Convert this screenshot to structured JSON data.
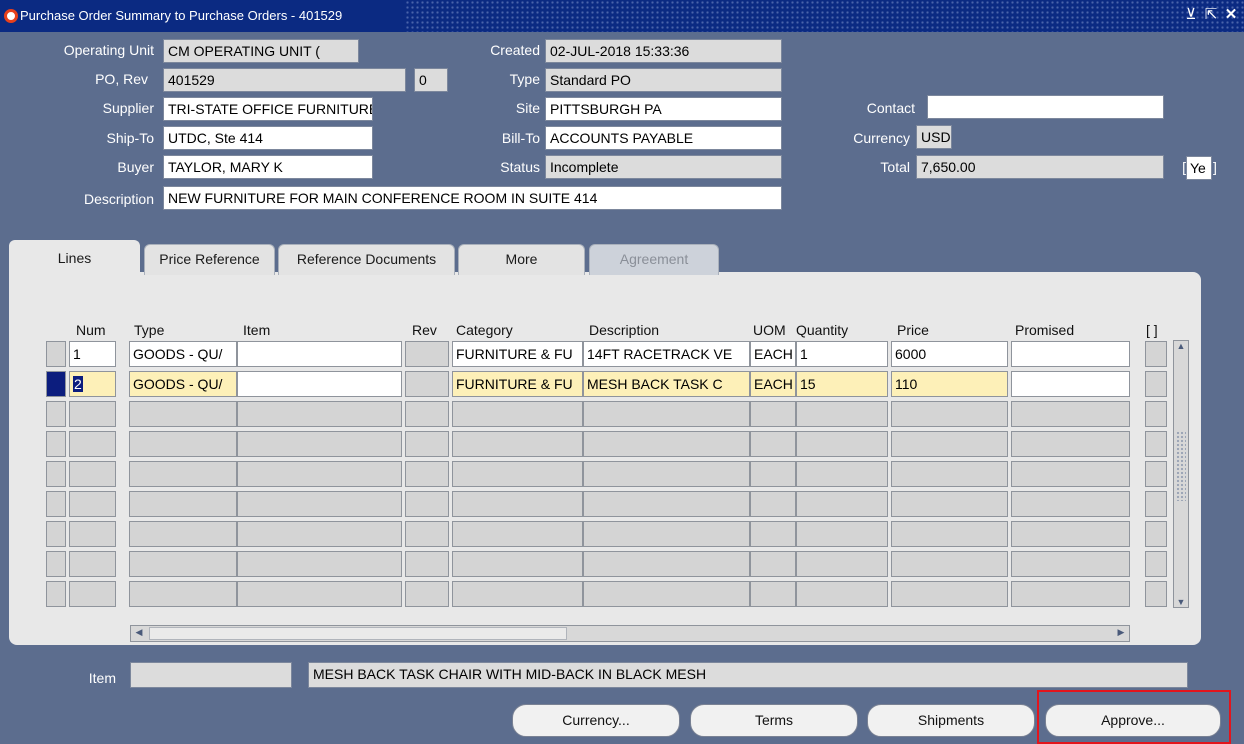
{
  "window": {
    "title": "Purchase Order Summary to Purchase Orders - 401529",
    "controls": [
      "minimize-icon",
      "maximize-icon",
      "close-icon"
    ]
  },
  "header": {
    "operating_unit_label": "Operating Unit",
    "operating_unit": "CM OPERATING UNIT (",
    "created_label": "Created",
    "created": "02-JUL-2018 15:33:36",
    "po_rev_label": "PO, Rev",
    "po": "401529",
    "rev": "0",
    "type_label": "Type",
    "type": "Standard PO",
    "supplier_label": "Supplier",
    "supplier": "TRI-STATE OFFICE FURNITURE",
    "site_label": "Site",
    "site": "PITTSBURGH PA",
    "contact_label": "Contact",
    "contact": "",
    "ship_to_label": "Ship-To",
    "ship_to": "UTDC, Ste 414",
    "bill_to_label": "Bill-To",
    "bill_to": "ACCOUNTS PAYABLE",
    "currency_label": "Currency",
    "currency": "USD",
    "buyer_label": "Buyer",
    "buyer": "TAYLOR, MARY K",
    "status_label": "Status",
    "status": "Incomplete",
    "total_label": "Total",
    "total": "7,650.00",
    "flag_open": "[",
    "flag_value": "Ye",
    "flag_close": "]",
    "description_label": "Description",
    "description": "NEW FURNITURE FOR MAIN CONFERENCE ROOM IN SUITE 414"
  },
  "tabs": [
    "Lines",
    "Price Reference",
    "Reference Documents",
    "More",
    "Agreement"
  ],
  "table": {
    "columns": [
      "Num",
      "Type",
      "Item",
      "Rev",
      "Category",
      "Description",
      "UOM",
      "Quantity",
      "Price",
      "Promised",
      "[ ]"
    ],
    "rows": [
      {
        "num": "1",
        "type": "GOODS - QU/",
        "item": "",
        "rev": "",
        "category": "FURNITURE & FU",
        "description": "14FT RACETRACK VE",
        "uom": "EACH",
        "quantity": "1",
        "price": "6000",
        "promised": ""
      },
      {
        "num": "2",
        "type": "GOODS - QU/",
        "item": "",
        "rev": "",
        "category": "FURNITURE & FU",
        "description": "MESH BACK TASK C",
        "uom": "EACH",
        "quantity": "15",
        "price": "110",
        "promised": ""
      }
    ]
  },
  "footer": {
    "item_label": "Item",
    "item_value": "",
    "item_description": "MESH BACK TASK CHAIR WITH MID-BACK IN BLACK MESH"
  },
  "buttons": {
    "currency": "Currency...",
    "terms": "Terms",
    "shipments": "Shipments",
    "approve": "Approve..."
  },
  "colors": {
    "background": "#5c6d8e",
    "title_bar": "#0b2a82",
    "selected_row": "#fdf0b8",
    "highlight": "#e3151c"
  }
}
